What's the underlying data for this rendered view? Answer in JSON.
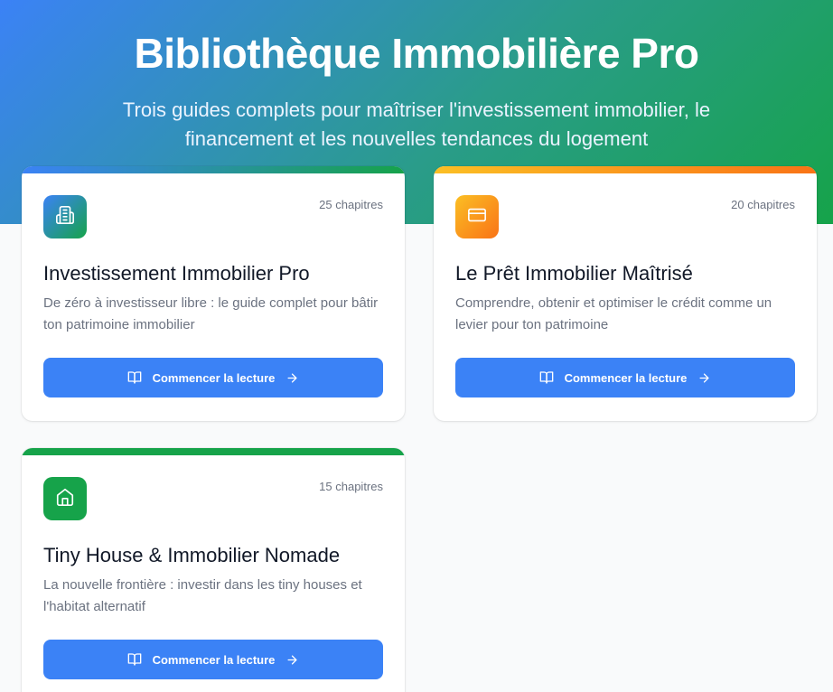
{
  "header": {
    "title": "Bibliothèque Immobilière Pro",
    "subtitle": "Trois guides complets pour maîtriser l'investissement immobilier, le financement et les nouvelles tendances du logement"
  },
  "colors": {
    "hero_gradient": [
      "#3b82f6",
      "#16a34a"
    ],
    "button": "#3b82f6"
  },
  "books": [
    {
      "title": "Investissement Immobilier Pro",
      "description": "De zéro à investisseur libre : le guide complet pour bâtir ton patrimoine immobilier",
      "chapters": "25 chapitres",
      "cta": "Commencer la lecture",
      "icon": "building-icon",
      "accent": [
        "#3b82f6",
        "#16a34a"
      ]
    },
    {
      "title": "Le Prêt Immobilier Maîtrisé",
      "description": "Comprendre, obtenir et optimiser le crédit comme un levier pour ton patrimoine",
      "chapters": "20 chapitres",
      "cta": "Commencer la lecture",
      "icon": "credit-card-icon",
      "accent": [
        "#fbbf24",
        "#f97316"
      ]
    },
    {
      "title": "Tiny House & Immobilier Nomade",
      "description": "La nouvelle frontière : investir dans les tiny houses et l'habitat alternatif",
      "chapters": "15 chapitres",
      "cta": "Commencer la lecture",
      "icon": "home-icon",
      "accent": [
        "#16a34a",
        "#16a34a"
      ]
    }
  ]
}
